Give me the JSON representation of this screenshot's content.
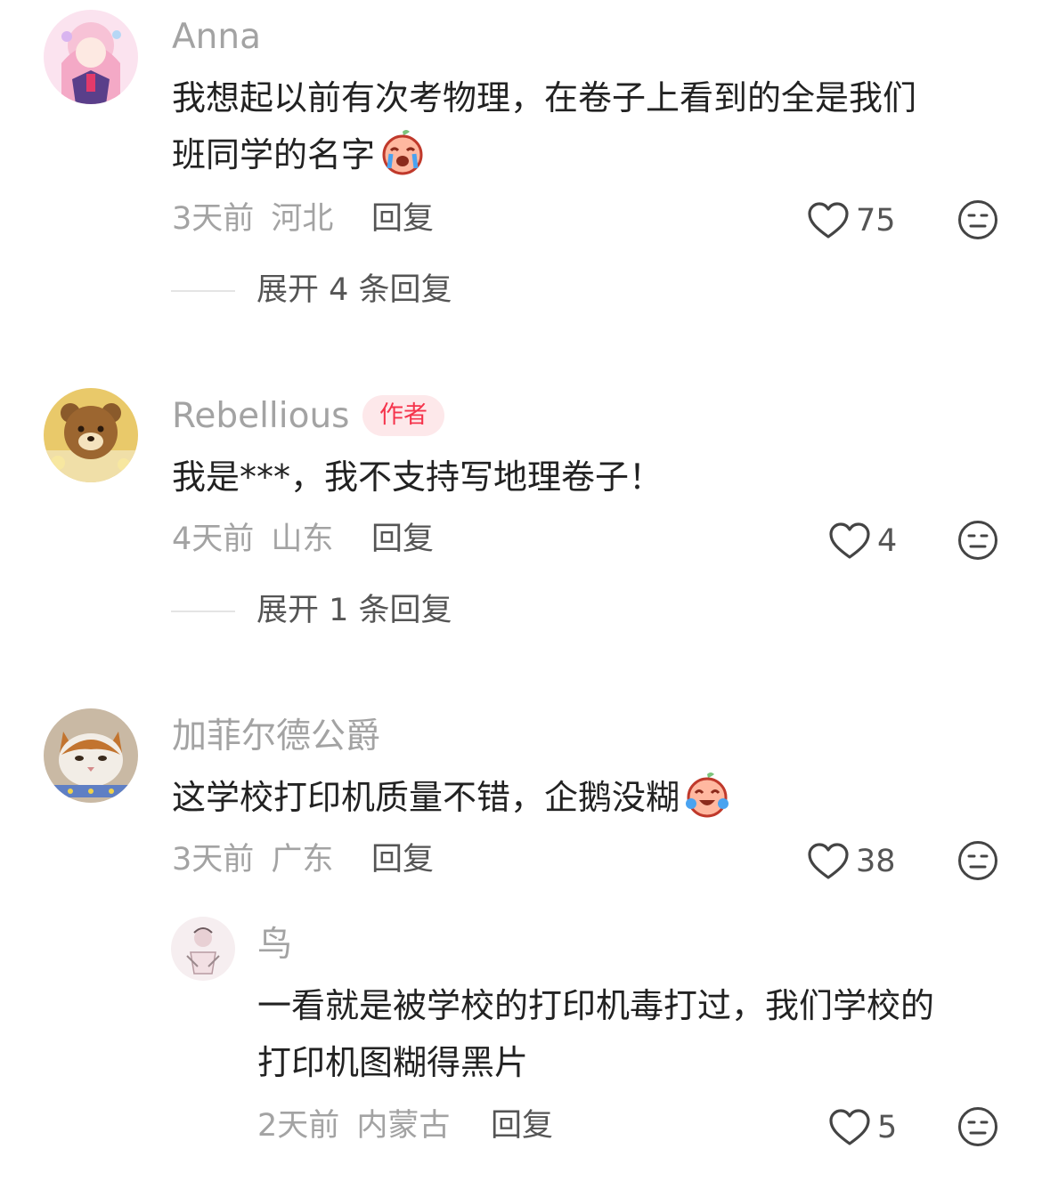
{
  "comments": [
    {
      "username": "Anna",
      "avatar_icon": "anime-girl-avatar",
      "content_lines": [
        "我想起以前有次考物理，在卷子上看到的全是我们",
        "班同学的名字"
      ],
      "emoji": "crying-peach-emoji",
      "time": "3天前",
      "location": "河北",
      "reply_label": "回复",
      "like_count": "75",
      "expand_label": "展开 4 条回复"
    },
    {
      "username": "Rebellious",
      "author_badge": "作者",
      "avatar_icon": "bear-avatar",
      "content_lines": [
        "我是***，我不支持写地理卷子！"
      ],
      "time": "4天前",
      "location": "山东",
      "reply_label": "回复",
      "like_count": "4",
      "expand_label": "展开 1 条回复"
    },
    {
      "username": "加菲尔德公爵",
      "avatar_icon": "cat-avatar",
      "content_lines": [
        "这学校打印机质量不错，企鹅没糊"
      ],
      "emoji": "laughing-crying-peach-emoji",
      "time": "3天前",
      "location": "广东",
      "reply_label": "回复",
      "like_count": "38"
    }
  ],
  "reply": {
    "username": "鸟",
    "avatar_icon": "sketch-avatar",
    "content_lines": [
      "一看就是被学校的打印机毒打过，我们学校的",
      "打印机图糊得黑片"
    ],
    "time": "2天前",
    "location": "内蒙古",
    "reply_label": "回复",
    "like_count": "5"
  },
  "colors": {
    "username": "#a3a3a3",
    "badge_bg": "#fde8ea",
    "badge_text": "#f5344c",
    "content": "#222222",
    "meta": "#a3a3a3",
    "action": "#555555"
  },
  "icons": {
    "like": "heart-outline-icon",
    "dislike": "meh-face-icon"
  }
}
